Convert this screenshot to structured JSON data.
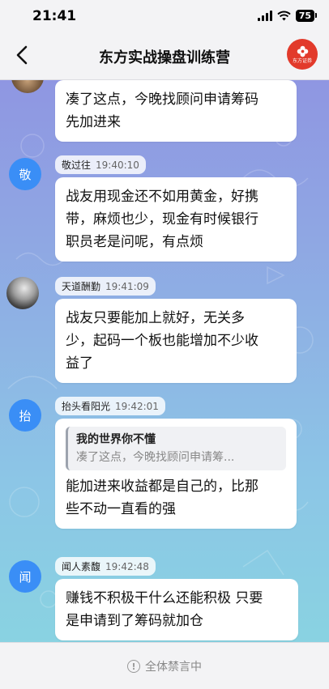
{
  "status_bar": {
    "time": "21:41",
    "battery": "75"
  },
  "header": {
    "title": "东方实战操盘训练营",
    "logo_text": "东方证券"
  },
  "messages": [
    {
      "avatar": "",
      "sender": "",
      "time": "",
      "text": "凑了这点，今晚找顾问申请筹码先加进来",
      "lines": [
        "凑了这点，今晚找顾问申请筹码",
        "先加进来"
      ]
    },
    {
      "avatar": "敬",
      "sender": "敬过往",
      "time": "19:40:10",
      "text": "战友用现金还不如用黄金，好携带，麻烦也少，现金有时候银行职员老是问呢，有点烦",
      "lines": [
        "战友用现金还不如用黄金，好携",
        "带，麻烦也少，现金有时候银行",
        "职员老是问呢，有点烦"
      ]
    },
    {
      "avatar": "",
      "sender": "天道酬勤",
      "time": "19:41:09",
      "text": "战友只要能加上就好，无关多少，起码一个板也能增加不少收益了",
      "lines": [
        "战友只要能加上就好，无关多",
        "少，起码一个板也能增加不少收",
        "益了"
      ]
    },
    {
      "avatar": "抬",
      "sender": "抬头看阳光",
      "time": "19:42:01",
      "quote_name": "我的世界你不懂",
      "quote_text": "凑了这点，今晚找顾问申请筹...",
      "text": "能加进来收益都是自己的，比那些不动一直看的强",
      "lines": [
        "能加进来收益都是自己的，比那",
        "些不动一直看的强"
      ]
    },
    {
      "avatar": "闻",
      "sender": "闻人素馥",
      "time": "19:42:48",
      "text": "赚钱不积极干什么还能积极 只要是申请到了筹码就加仓",
      "lines": [
        "赚钱不积极干什么还能积极 只要",
        "是申请到了筹码就加仓"
      ]
    }
  ],
  "footer": {
    "text": "全体禁言中",
    "icon": "info-icon"
  }
}
